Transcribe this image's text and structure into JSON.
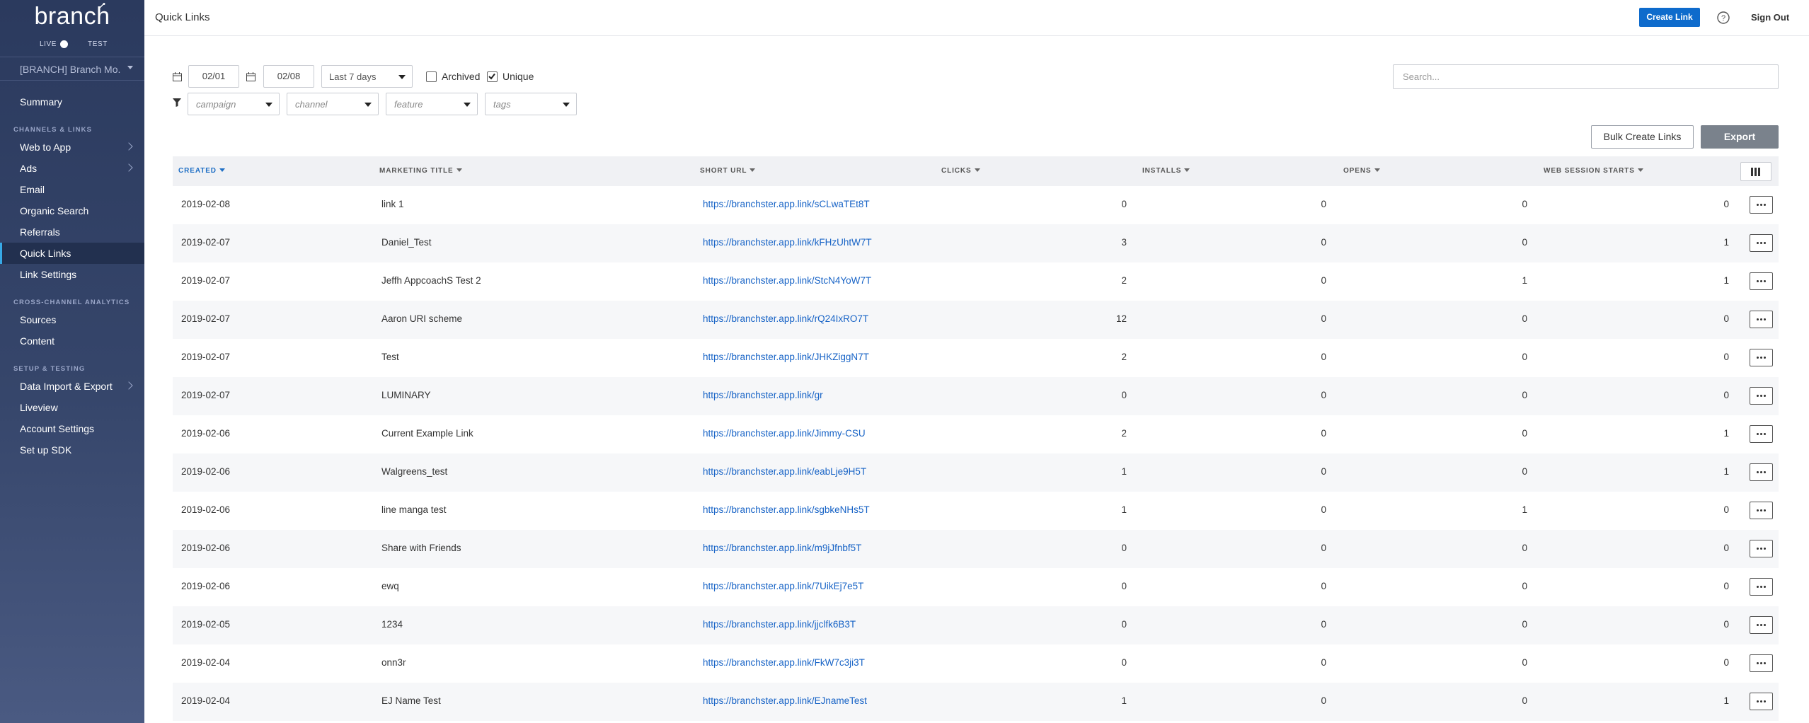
{
  "sidebar": {
    "brand": "branch",
    "env": {
      "live": "LIVE",
      "test": "TEST"
    },
    "org": "[BRANCH] Branch Mo...",
    "summary": "Summary",
    "sections": {
      "channels": "CHANNELS & LINKS",
      "analytics": "CROSS-CHANNEL ANALYTICS",
      "setup": "SETUP & TESTING"
    },
    "items": {
      "web_to_app": "Web to App",
      "ads": "Ads",
      "email": "Email",
      "organic_search": "Organic Search",
      "referrals": "Referrals",
      "quick_links": "Quick Links",
      "link_settings": "Link Settings",
      "sources": "Sources",
      "content": "Content",
      "data_import_export": "Data Import & Export",
      "liveview": "Liveview",
      "account_settings": "Account Settings",
      "setup_sdk": "Set up SDK"
    }
  },
  "header": {
    "title": "Quick Links",
    "create_link": "Create Link",
    "sign_out": "Sign Out"
  },
  "filters": {
    "date_from": "02/01",
    "date_to": "02/08",
    "range": "Last 7 days",
    "archived_label": "Archived",
    "archived_checked": false,
    "unique_label": "Unique",
    "unique_checked": true,
    "search_placeholder": "Search...",
    "campaign": "campaign",
    "channel": "channel",
    "feature": "feature",
    "tags": "tags"
  },
  "actions": {
    "bulk_create": "Bulk Create Links",
    "export": "Export"
  },
  "table": {
    "columns": {
      "created": "CREATED",
      "title": "MARKETING TITLE",
      "url": "SHORT URL",
      "clicks": "CLICKS",
      "installs": "INSTALLS",
      "opens": "OPENS",
      "web_sessions": "WEB SESSION STARTS"
    },
    "rows": [
      {
        "created": "2019-02-08",
        "title": "link 1",
        "url": "https://branchster.app.link/sCLwaTEt8T",
        "clicks": "0",
        "installs": "0",
        "opens": "0",
        "web": "0"
      },
      {
        "created": "2019-02-07",
        "title": "Daniel_Test",
        "url": "https://branchster.app.link/kFHzUhtW7T",
        "clicks": "3",
        "installs": "0",
        "opens": "0",
        "web": "1"
      },
      {
        "created": "2019-02-07",
        "title": "Jeffh AppcoachS Test 2",
        "url": "https://branchster.app.link/StcN4YoW7T",
        "clicks": "2",
        "installs": "0",
        "opens": "1",
        "web": "1"
      },
      {
        "created": "2019-02-07",
        "title": "Aaron URI scheme",
        "url": "https://branchster.app.link/rQ24IxRO7T",
        "clicks": "12",
        "installs": "0",
        "opens": "0",
        "web": "0"
      },
      {
        "created": "2019-02-07",
        "title": "Test",
        "url": "https://branchster.app.link/JHKZiggN7T",
        "clicks": "2",
        "installs": "0",
        "opens": "0",
        "web": "0"
      },
      {
        "created": "2019-02-07",
        "title": "LUMINARY",
        "url": "https://branchster.app.link/gr",
        "clicks": "0",
        "installs": "0",
        "opens": "0",
        "web": "0"
      },
      {
        "created": "2019-02-06",
        "title": "Current Example Link",
        "url": "https://branchster.app.link/Jimmy-CSU",
        "clicks": "2",
        "installs": "0",
        "opens": "0",
        "web": "1"
      },
      {
        "created": "2019-02-06",
        "title": "Walgreens_test",
        "url": "https://branchster.app.link/eabLje9H5T",
        "clicks": "1",
        "installs": "0",
        "opens": "0",
        "web": "1"
      },
      {
        "created": "2019-02-06",
        "title": "line manga test",
        "url": "https://branchster.app.link/sgbkeNHs5T",
        "clicks": "1",
        "installs": "0",
        "opens": "1",
        "web": "0"
      },
      {
        "created": "2019-02-06",
        "title": "Share with Friends",
        "url": "https://branchster.app.link/m9jJfnbf5T",
        "clicks": "0",
        "installs": "0",
        "opens": "0",
        "web": "0"
      },
      {
        "created": "2019-02-06",
        "title": "ewq",
        "url": "https://branchster.app.link/7UikEj7e5T",
        "clicks": "0",
        "installs": "0",
        "opens": "0",
        "web": "0"
      },
      {
        "created": "2019-02-05",
        "title": "1234",
        "url": "https://branchster.app.link/jjclfk6B3T",
        "clicks": "0",
        "installs": "0",
        "opens": "0",
        "web": "0"
      },
      {
        "created": "2019-02-04",
        "title": "onn3r",
        "url": "https://branchster.app.link/FkW7c3ji3T",
        "clicks": "0",
        "installs": "0",
        "opens": "0",
        "web": "0"
      },
      {
        "created": "2019-02-04",
        "title": "EJ Name Test",
        "url": "https://branchster.app.link/EJnameTest",
        "clicks": "1",
        "installs": "0",
        "opens": "0",
        "web": "1"
      }
    ]
  },
  "colors": {
    "accent": "#0e6bcc",
    "link": "#1763c6",
    "sidebar": "#2b3a5e"
  },
  "icons": {
    "calendar": "calendar-icon",
    "filter": "filter-icon",
    "help": "help-icon",
    "columns": "columns-icon",
    "more": "more-icon"
  }
}
